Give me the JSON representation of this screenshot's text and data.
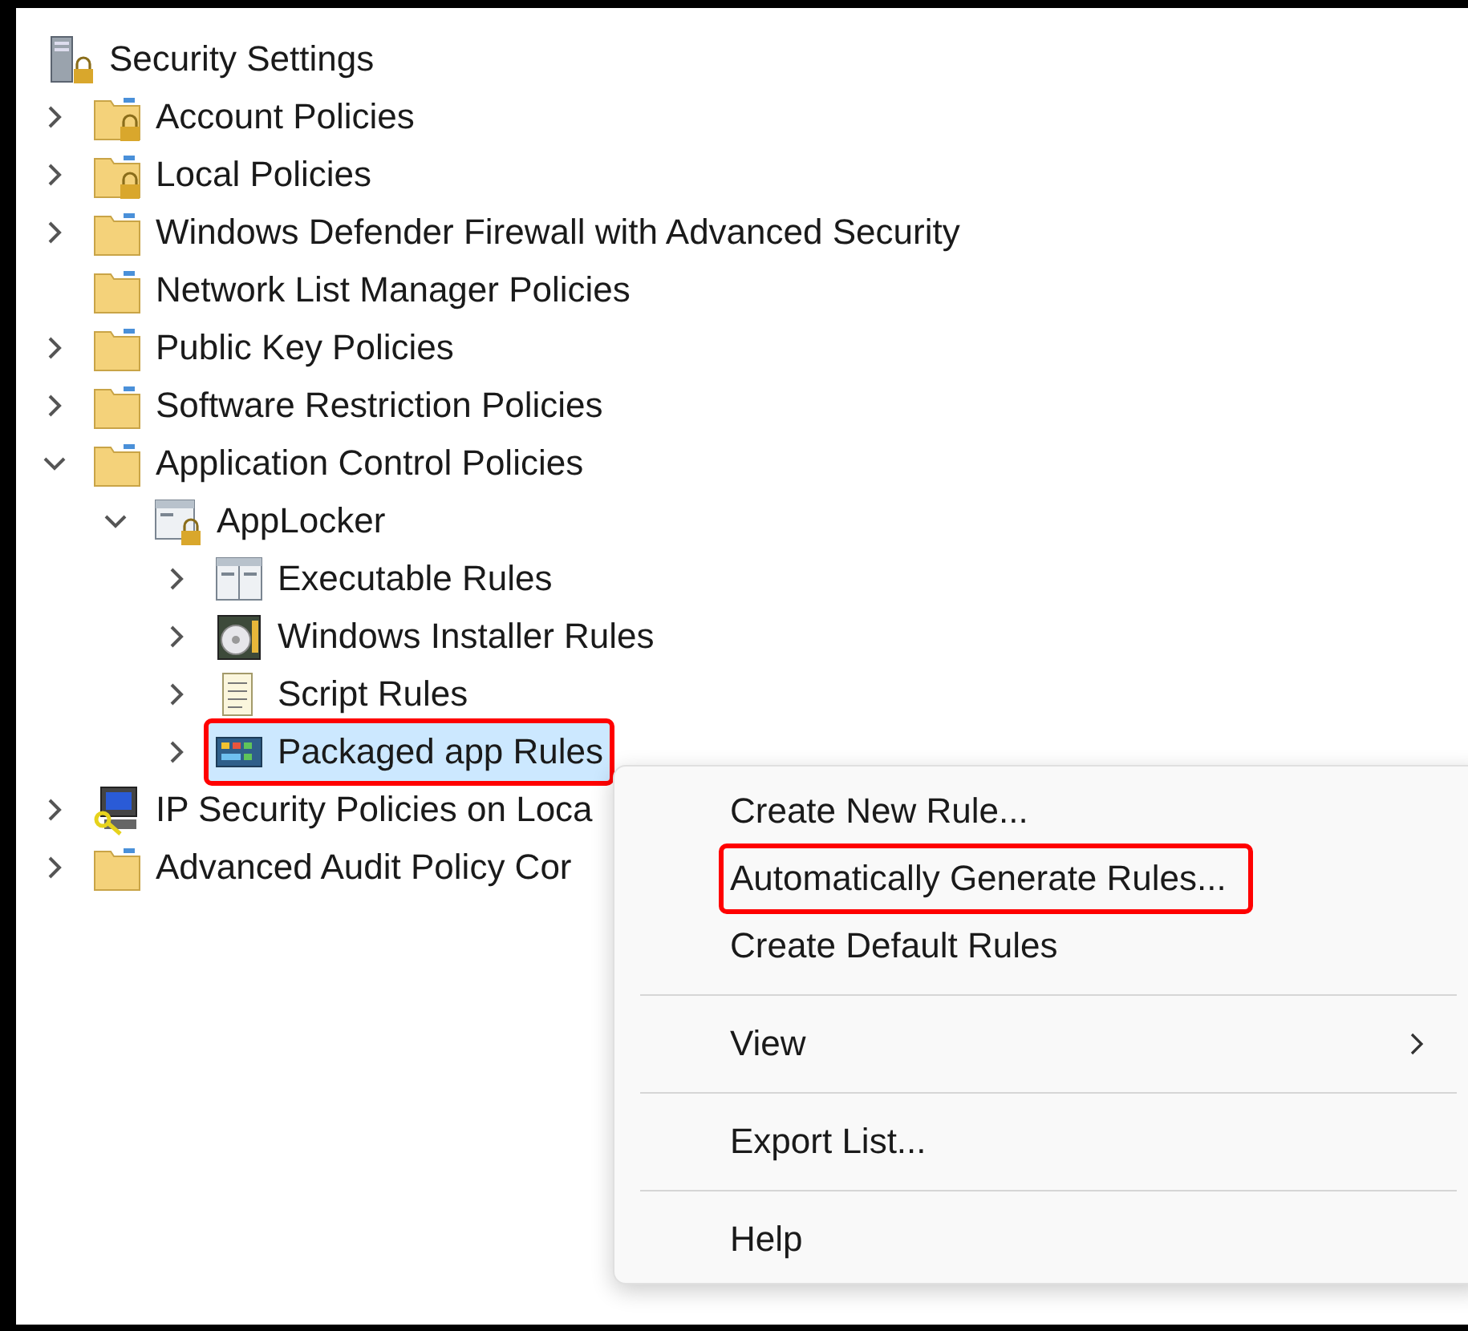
{
  "tree": {
    "label": "Security Settings",
    "kind": "server-lock",
    "children": [
      {
        "label": "Account Policies",
        "kind": "locked-folder",
        "expandable": true,
        "expanded": false,
        "selected": false,
        "outlined": false
      },
      {
        "label": "Local Policies",
        "kind": "locked-folder",
        "expandable": true,
        "expanded": false,
        "selected": false,
        "outlined": false
      },
      {
        "label": "Windows Defender Firewall with Advanced Security",
        "kind": "folder",
        "expandable": true,
        "expanded": false,
        "selected": false,
        "outlined": false
      },
      {
        "label": "Network List Manager Policies",
        "kind": "folder",
        "expandable": false,
        "selected": false,
        "outlined": false
      },
      {
        "label": "Public Key Policies",
        "kind": "folder",
        "expandable": true,
        "expanded": false,
        "selected": false,
        "outlined": false
      },
      {
        "label": "Software Restriction Policies",
        "kind": "folder",
        "expandable": true,
        "expanded": false,
        "selected": false,
        "outlined": false
      },
      {
        "label": "Application Control Policies",
        "kind": "folder",
        "expandable": true,
        "expanded": true,
        "selected": false,
        "outlined": false,
        "children": [
          {
            "label": "AppLocker",
            "kind": "applocker",
            "expandable": true,
            "expanded": true,
            "selected": false,
            "outlined": false,
            "children": [
              {
                "label": "Executable Rules",
                "kind": "window",
                "expandable": true,
                "expanded": false,
                "selected": false,
                "outlined": false
              },
              {
                "label": "Windows Installer Rules",
                "kind": "installer",
                "expandable": true,
                "expanded": false,
                "selected": false,
                "outlined": false
              },
              {
                "label": "Script Rules",
                "kind": "script",
                "expandable": true,
                "expanded": false,
                "selected": false,
                "outlined": false
              },
              {
                "label": "Packaged app Rules",
                "kind": "packaged",
                "expandable": true,
                "expanded": false,
                "selected": true,
                "outlined": true
              }
            ]
          }
        ]
      },
      {
        "label": "IP Security Policies on Loca",
        "kind": "ip-security",
        "expandable": true,
        "expanded": false,
        "selected": false,
        "outlined": false
      },
      {
        "label": "Advanced Audit Policy Cor",
        "kind": "folder",
        "expandable": true,
        "expanded": false,
        "selected": false,
        "outlined": false
      }
    ]
  },
  "context_menu": {
    "items": [
      {
        "kind": "item",
        "label": "Create New Rule...",
        "outlined": false
      },
      {
        "kind": "item",
        "label": "Automatically Generate Rules...",
        "outlined": true
      },
      {
        "kind": "item",
        "label": "Create Default Rules",
        "outlined": false
      },
      {
        "kind": "separator"
      },
      {
        "kind": "submenu",
        "label": "View",
        "outlined": false
      },
      {
        "kind": "separator"
      },
      {
        "kind": "item",
        "label": "Export List...",
        "outlined": false
      },
      {
        "kind": "separator"
      },
      {
        "kind": "item",
        "label": "Help",
        "outlined": false
      }
    ]
  }
}
